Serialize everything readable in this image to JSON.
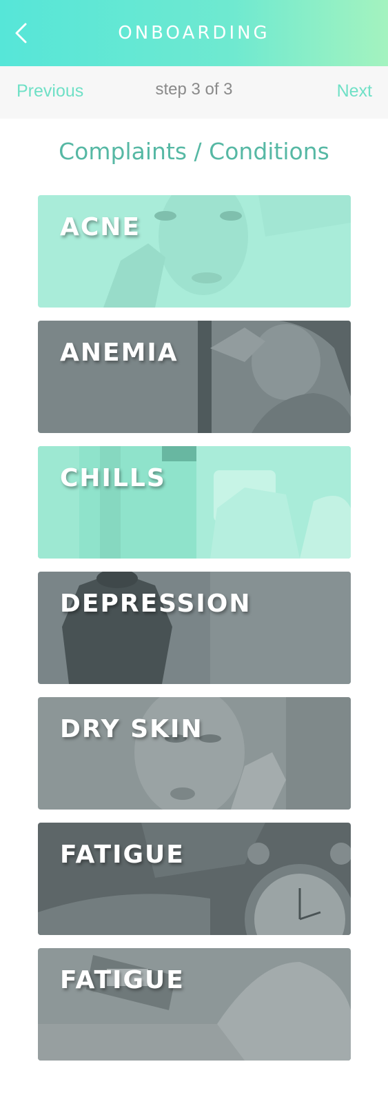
{
  "header": {
    "title": "ONBOARDING",
    "back_icon": "chevron-left-icon"
  },
  "stepbar": {
    "previous": "Previous",
    "step": "step 3 of 3",
    "next": "Next"
  },
  "section": {
    "title": "Complaints / Conditions"
  },
  "conditions": [
    {
      "label": "ACNE",
      "tint": "#a9ecd9"
    },
    {
      "label": "ANEMIA",
      "tint": "#7b8688"
    },
    {
      "label": "CHILLS",
      "tint": "#8fe3cb"
    },
    {
      "label": "DEPRESSION",
      "tint": "#7a8588"
    },
    {
      "label": "DRY SKIN",
      "tint": "#8c9697"
    },
    {
      "label": "FATIGUE",
      "tint": "#5d6668"
    },
    {
      "label": "FATIGUE",
      "tint": "#8d9798"
    }
  ]
}
